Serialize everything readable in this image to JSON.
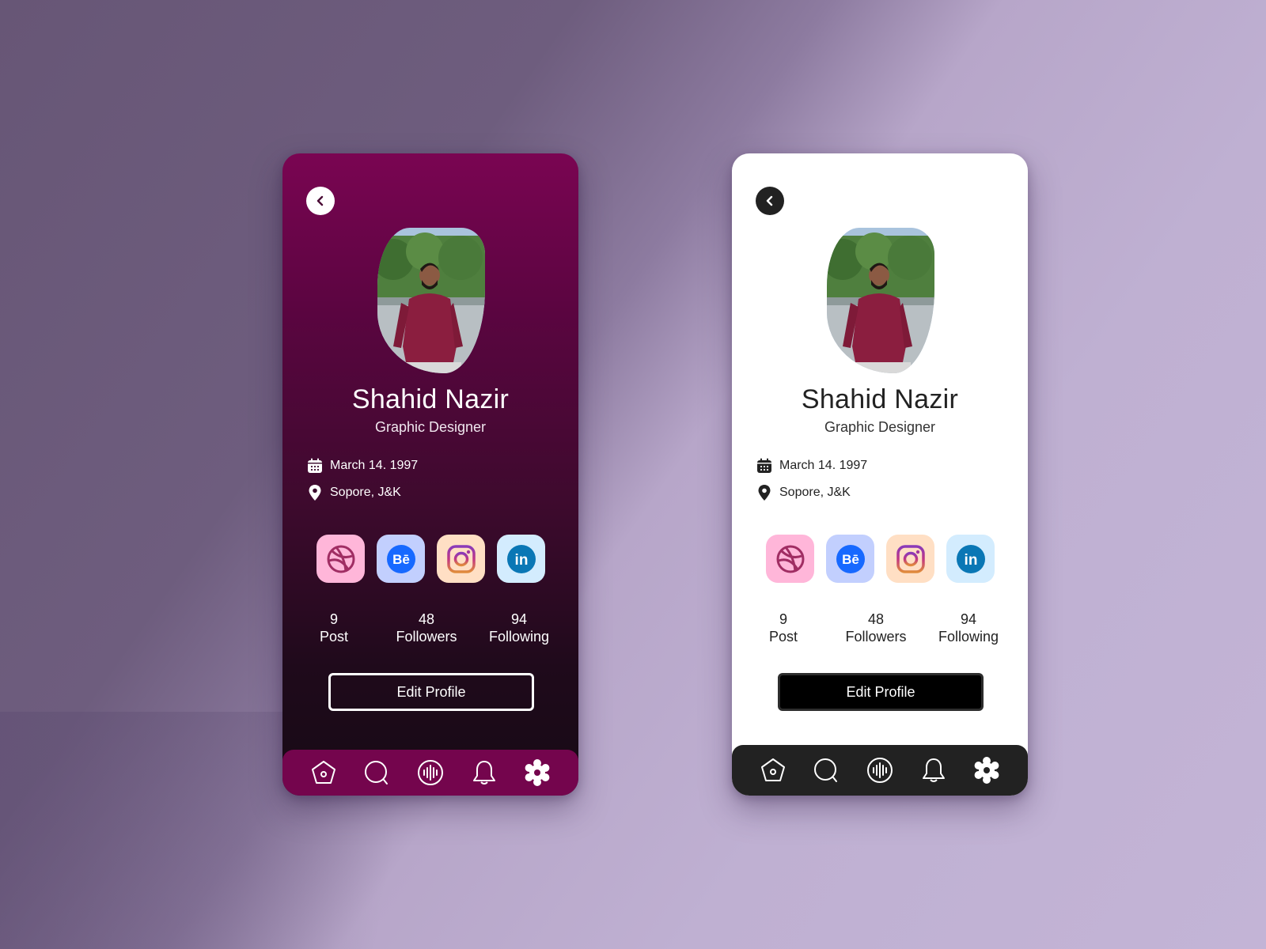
{
  "colors": {
    "dark_theme_top": "#7a0552",
    "dark_theme_bottom": "#170a15",
    "dark_nav": "#74054d",
    "light_nav": "#222222",
    "dribbble_bg": "#ffb6d9",
    "behance_bg": "#c2cffe",
    "instagram_bg": "#ffdfc4",
    "linkedin_bg": "#d3ecfe"
  },
  "profile": {
    "name": "Shahid Nazir",
    "role": "Graphic Designer",
    "birthday": "March 14. 1997",
    "location": "Sopore, J&K",
    "avatar_alt": "profile-photo"
  },
  "socials": [
    {
      "name": "Dribbble",
      "icon": "dribbble-icon"
    },
    {
      "name": "Behance",
      "icon": "behance-icon",
      "glyph": "Bē"
    },
    {
      "name": "Instagram",
      "icon": "instagram-icon"
    },
    {
      "name": "LinkedIn",
      "icon": "linkedin-icon",
      "glyph": "in"
    }
  ],
  "stats": [
    {
      "value": "9",
      "label": "Post"
    },
    {
      "value": "48",
      "label": "Followers"
    },
    {
      "value": "94",
      "label": "Following"
    }
  ],
  "actions": {
    "edit_profile": "Edit Profile",
    "back": "back"
  },
  "nav": [
    {
      "name": "home",
      "icon": "home-icon"
    },
    {
      "name": "search",
      "icon": "search-icon"
    },
    {
      "name": "audio",
      "icon": "audio-wave-icon"
    },
    {
      "name": "notifications",
      "icon": "bell-icon"
    },
    {
      "name": "settings",
      "icon": "gear-icon"
    }
  ]
}
